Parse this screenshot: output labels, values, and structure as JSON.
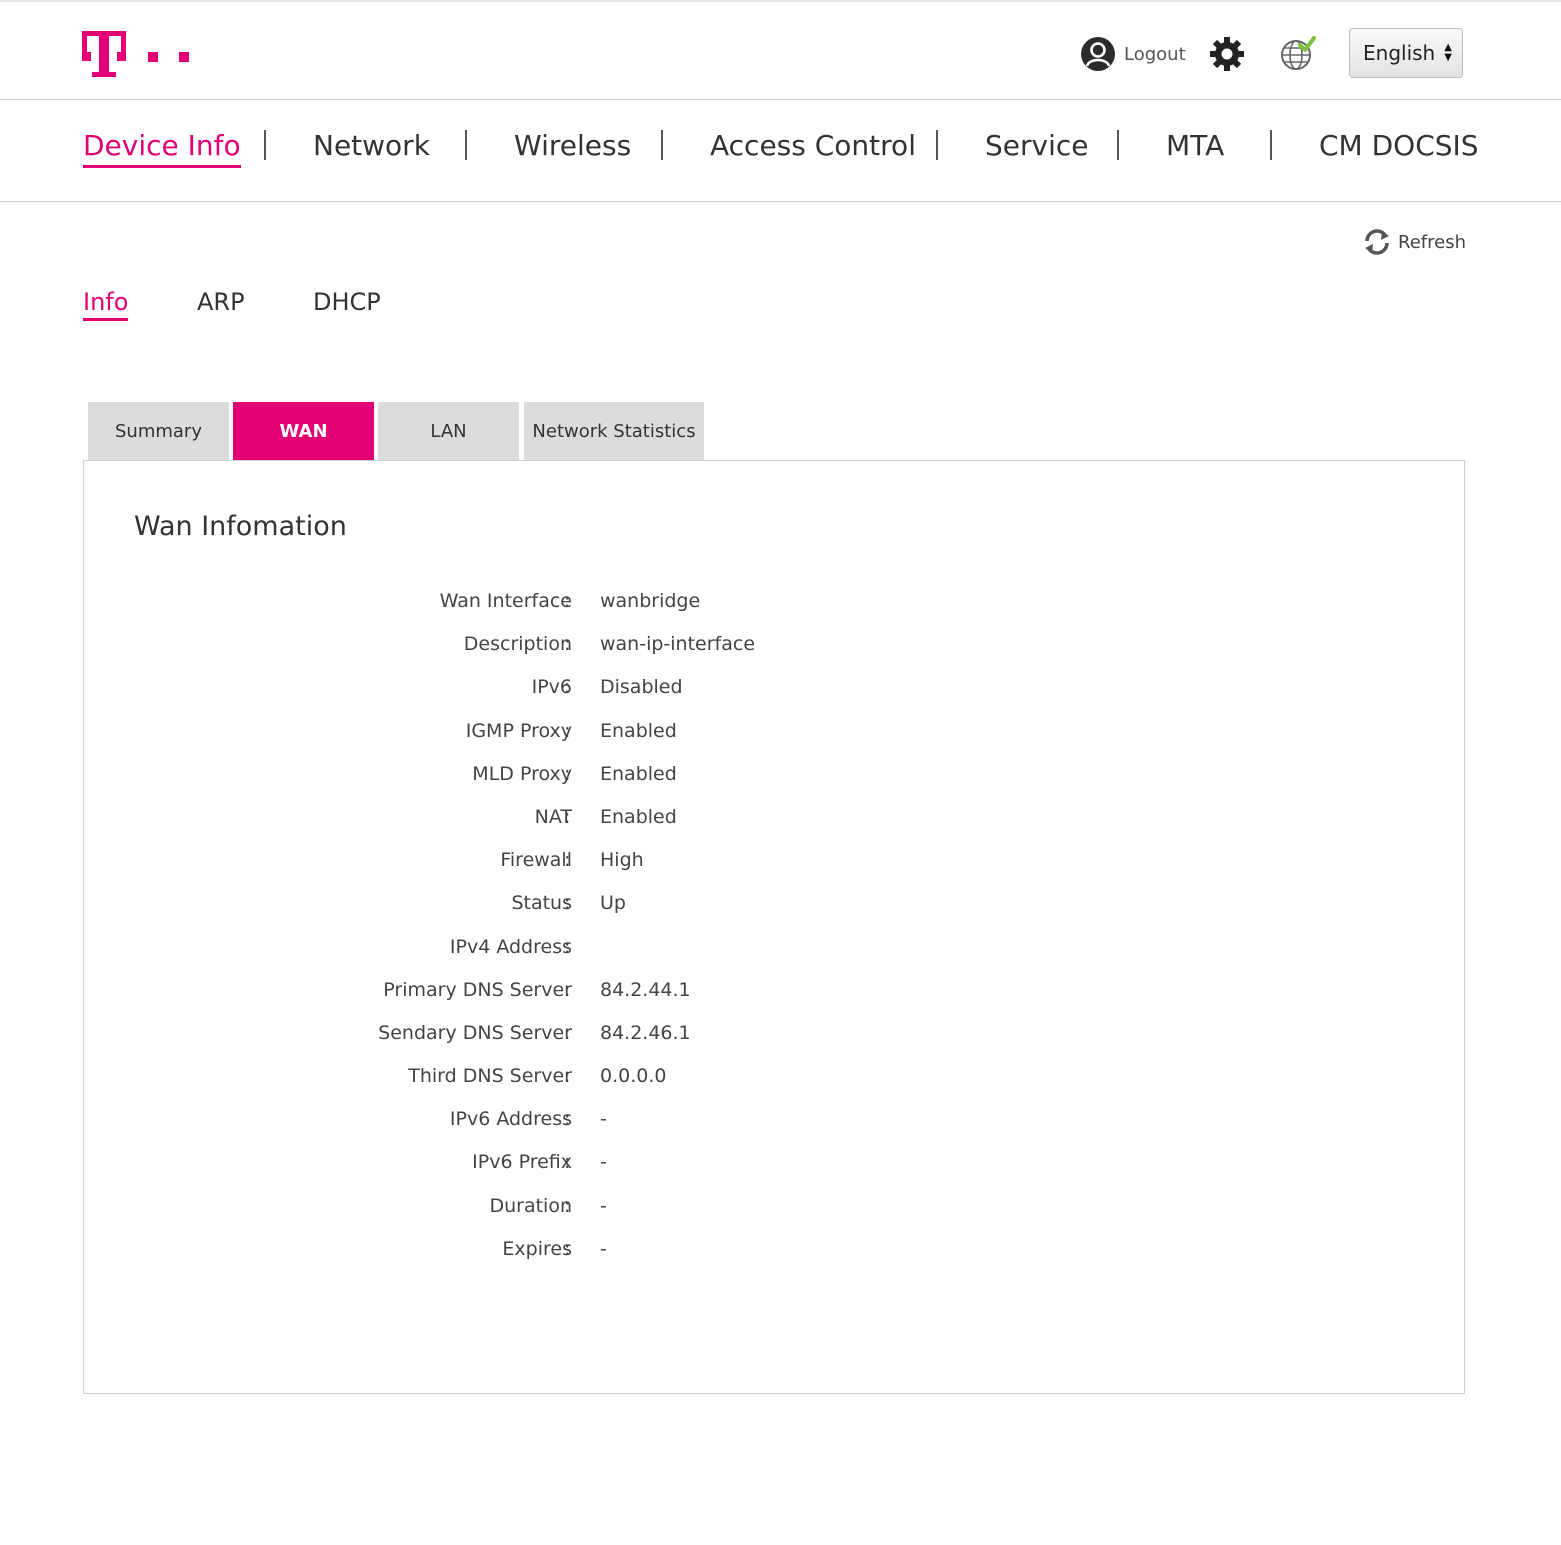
{
  "header": {
    "logout_label": "Logout",
    "language": {
      "selected": "English"
    }
  },
  "brand": {
    "color": "#e20074"
  },
  "main_nav": {
    "items": [
      {
        "label": "Device Info",
        "active": true
      },
      {
        "label": "Network",
        "active": false
      },
      {
        "label": "Wireless",
        "active": false
      },
      {
        "label": "Access Control",
        "active": false
      },
      {
        "label": "Service",
        "active": false
      },
      {
        "label": "MTA",
        "active": false
      },
      {
        "label": "CM DOCSIS",
        "active": false
      }
    ]
  },
  "refresh_label": "Refresh",
  "sub_nav": {
    "items": [
      {
        "label": "Info",
        "active": true
      },
      {
        "label": "ARP",
        "active": false
      },
      {
        "label": "DHCP",
        "active": false
      }
    ]
  },
  "tabs": [
    {
      "label": "Summary",
      "active": false
    },
    {
      "label": "WAN",
      "active": true
    },
    {
      "label": "LAN",
      "active": false
    },
    {
      "label": "Network Statistics",
      "active": false
    }
  ],
  "wan": {
    "title": "Wan Infomation",
    "separator": ":",
    "rows": [
      {
        "label": "Wan Interface",
        "value": "wanbridge"
      },
      {
        "label": "Description",
        "value": "wan-ip-interface"
      },
      {
        "label": "IPv6",
        "value": "Disabled"
      },
      {
        "label": "IGMP Proxy",
        "value": "Enabled"
      },
      {
        "label": "MLD Proxy",
        "value": "Enabled"
      },
      {
        "label": "NAT",
        "value": "Enabled"
      },
      {
        "label": "Firewall",
        "value": "High"
      },
      {
        "label": "Status",
        "value": "Up"
      },
      {
        "label": "IPv4 Address",
        "value": ""
      },
      {
        "label": "Primary DNS Server",
        "value": "84.2.44.1"
      },
      {
        "label": "Sendary DNS Server",
        "value": "84.2.46.1"
      },
      {
        "label": "Third DNS Server",
        "value": "0.0.0.0"
      },
      {
        "label": "IPv6 Address",
        "value": "-"
      },
      {
        "label": "IPv6 Prefix",
        "value": "-"
      },
      {
        "label": "Duration",
        "value": "-"
      },
      {
        "label": "Expires",
        "value": "-"
      }
    ]
  }
}
